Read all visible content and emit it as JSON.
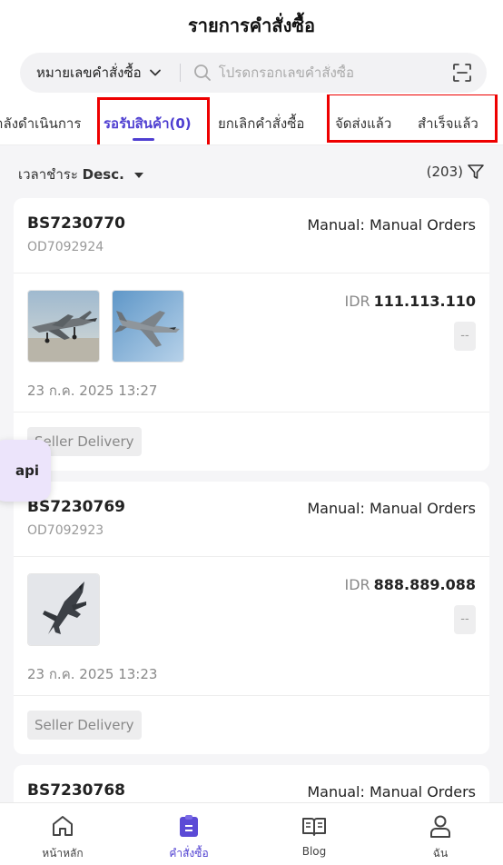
{
  "header": {
    "title": "รายการคำสั่งซื้อ"
  },
  "search": {
    "type_label": "หมายเลขคำสั่งซื้อ",
    "placeholder": "โปรดกรอกเลขคำสั่งซื้อ"
  },
  "tabs": [
    {
      "label": "กำลังดำเนินการ",
      "active": false
    },
    {
      "label": "รอรับสินค้า(0)",
      "active": true
    },
    {
      "label": "ยกเลิกคำสั่งซื้อ",
      "active": false
    },
    {
      "label": "จัดส่งแล้ว",
      "active": false
    },
    {
      "label": "สำเร็จแล้ว",
      "active": false
    }
  ],
  "sort": {
    "label": "เวลาชำระ",
    "order": "Desc."
  },
  "result_count": "(203)",
  "orders": [
    {
      "order_no": "BS7230770",
      "sub_no": "OD7092924",
      "channel": "Manual: Manual Orders",
      "currency": "IDR",
      "amount": "111.113.110",
      "action": "--",
      "time": "23 ก.ค. 2025 13:27",
      "tag": "Seller Delivery",
      "images": [
        "fighter-jet-parked",
        "fighter-jet-flying-sky"
      ]
    },
    {
      "order_no": "BS7230769",
      "sub_no": "OD7092923",
      "channel": "Manual: Manual Orders",
      "currency": "IDR",
      "amount": "888.889.088",
      "action": "--",
      "time": "23 ก.ค. 2025 13:23",
      "tag": "Seller Delivery",
      "images": [
        "stealth-fighter-jet"
      ]
    },
    {
      "order_no": "BS7230768",
      "channel": "Manual: Manual Orders"
    }
  ],
  "floating_button": {
    "label": "api"
  },
  "bottom_nav": [
    {
      "label": "หน้าหลัก",
      "icon": "home-icon",
      "active": false
    },
    {
      "label": "คำสั่งซื้อ",
      "icon": "order-clipboard-icon",
      "active": true
    },
    {
      "label": "Blog",
      "icon": "book-icon",
      "active": false
    },
    {
      "label": "ฉัน",
      "icon": "user-icon",
      "active": false
    }
  ],
  "colors": {
    "accent": "#4f3fd1",
    "highlight_box": "#ee0000",
    "background": "#f5f5f7"
  }
}
